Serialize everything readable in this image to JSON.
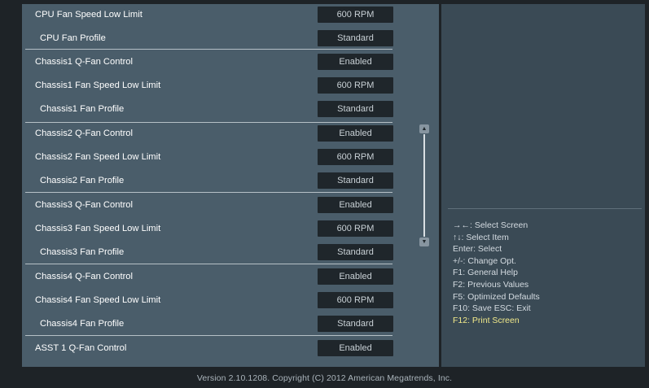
{
  "settings": [
    {
      "label": "CPU Fan Speed Low Limit",
      "value": "600 RPM",
      "indent": false
    },
    {
      "label": "CPU Fan Profile",
      "value": "Standard",
      "indent": true
    },
    {
      "label": "Chassis1 Q-Fan Control",
      "value": "Enabled",
      "indent": false
    },
    {
      "label": "Chassis1 Fan Speed Low Limit",
      "value": "600 RPM",
      "indent": false
    },
    {
      "label": "Chassis1 Fan Profile",
      "value": "Standard",
      "indent": true
    },
    {
      "label": "Chassis2 Q-Fan Control",
      "value": "Enabled",
      "indent": false
    },
    {
      "label": "Chassis2 Fan Speed Low Limit",
      "value": "600 RPM",
      "indent": false
    },
    {
      "label": "Chassis2 Fan Profile",
      "value": "Standard",
      "indent": true
    },
    {
      "label": "Chassis3 Q-Fan Control",
      "value": "Enabled",
      "indent": false
    },
    {
      "label": "Chassis3 Fan Speed Low Limit",
      "value": "600 RPM",
      "indent": false
    },
    {
      "label": "Chassis3 Fan Profile",
      "value": "Standard",
      "indent": true
    },
    {
      "label": "Chassis4 Q-Fan Control",
      "value": "Enabled",
      "indent": false
    },
    {
      "label": "Chassis4 Fan Speed Low Limit",
      "value": "600 RPM",
      "indent": false
    },
    {
      "label": "Chassis4 Fan Profile",
      "value": "Standard",
      "indent": true
    },
    {
      "label": "ASST 1 Q-Fan Control",
      "value": "Enabled",
      "indent": false
    }
  ],
  "help": [
    {
      "text": "→←: Select Screen",
      "highlight": false
    },
    {
      "text": "↑↓: Select Item",
      "highlight": false
    },
    {
      "text": "Enter: Select",
      "highlight": false
    },
    {
      "text": "+/-: Change Opt.",
      "highlight": false
    },
    {
      "text": "F1: General Help",
      "highlight": false
    },
    {
      "text": "F2: Previous Values",
      "highlight": false
    },
    {
      "text": "F5: Optimized Defaults",
      "highlight": false
    },
    {
      "text": "F10: Save   ESC: Exit",
      "highlight": false
    },
    {
      "text": "F12: Print Screen",
      "highlight": true
    }
  ],
  "scrollbar": {
    "up_glyph": "▲",
    "down_glyph": "▼"
  },
  "footer": "Version 2.10.1208. Copyright (C) 2012 American Megatrends, Inc.",
  "colors": {
    "panel": "#4a5d6a",
    "value_box": "#1f262b",
    "highlight_text": "#f1e98a"
  }
}
